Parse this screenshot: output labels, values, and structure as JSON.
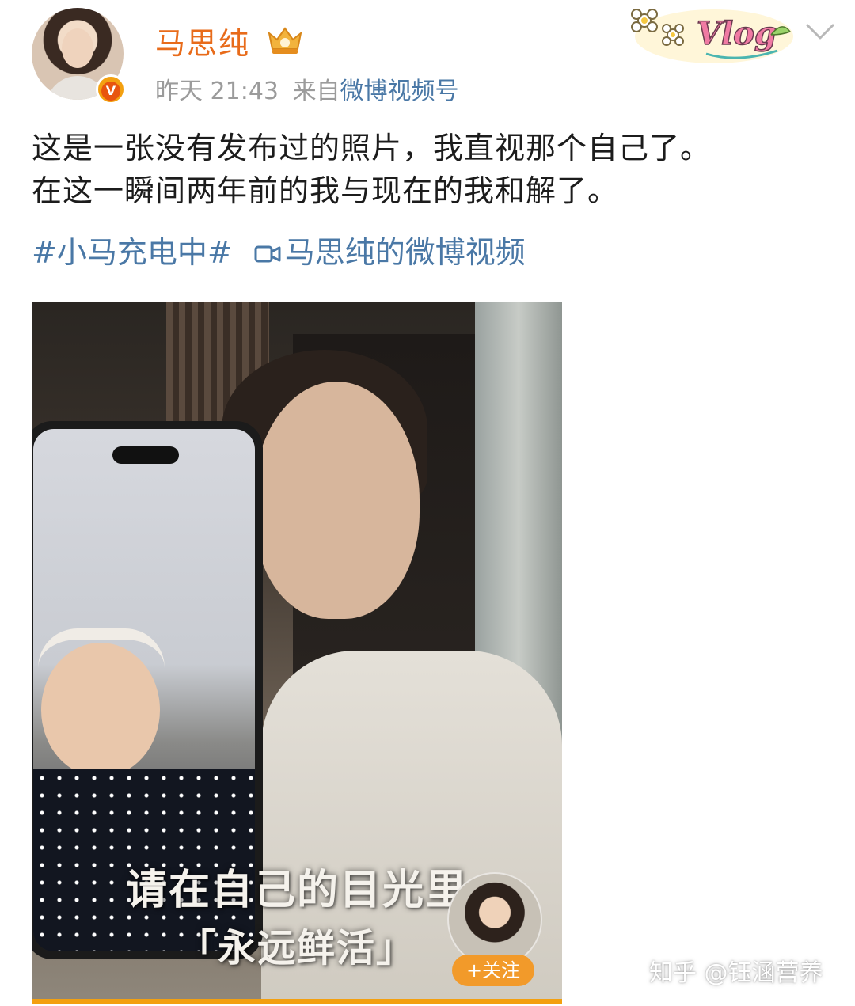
{
  "post": {
    "author": "马思纯",
    "verified_badge": "V",
    "timestamp_day": "昨天",
    "timestamp_time": "21:43",
    "source_prefix": "来自",
    "source_name": "微博视频号",
    "text_line1": "这是一张没有发布过的照片，我直视那个自己了。",
    "text_line2": "在这一瞬间两年前的我与现在的我和解了。",
    "hashtag": "#小马充电中#",
    "video_link": "马思纯的微博视频",
    "sticker_text": "Vlog"
  },
  "video": {
    "caption_line1": "请在自己的目光里",
    "caption_line2": "「永远鲜活」",
    "follow_label": "+关注",
    "progress": 1.0
  },
  "watermark": "知乎 @钰涵营养",
  "colors": {
    "name": "#e86b1a",
    "link": "#4a78a6",
    "follow": "#f29a2a"
  }
}
